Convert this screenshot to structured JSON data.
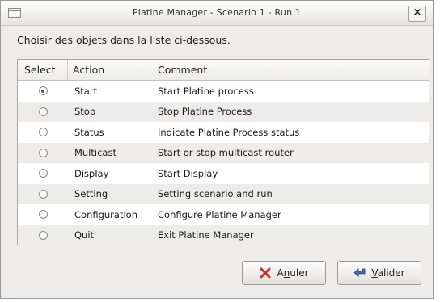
{
  "window": {
    "title": "Platine Manager - Scenario 1 - Run 1",
    "close_label": "×"
  },
  "instruction": "Choisir des objets dans la liste ci-dessous.",
  "table": {
    "headers": {
      "select": "Select",
      "action": "Action",
      "comment": "Comment"
    },
    "rows": [
      {
        "action": "Start",
        "comment": "Start Platine process",
        "selected": true
      },
      {
        "action": "Stop",
        "comment": "Stop Platine Process",
        "selected": false
      },
      {
        "action": "Status",
        "comment": "Indicate Platine Process status",
        "selected": false
      },
      {
        "action": "Multicast",
        "comment": "Start or stop multicast router",
        "selected": false
      },
      {
        "action": "Display",
        "comment": "Start Display",
        "selected": false
      },
      {
        "action": "Setting",
        "comment": "Setting scenario and run",
        "selected": false
      },
      {
        "action": "Configuration",
        "comment": "Configure Platine Manager",
        "selected": false
      },
      {
        "action": "Quit",
        "comment": "Exit Platine Manager",
        "selected": false
      }
    ]
  },
  "buttons": {
    "cancel": {
      "mnemonic": "n",
      "rest": "uler",
      "prefix": "A",
      "icon": "cancel-x-icon",
      "icon_color": "#d0301f"
    },
    "ok": {
      "mnemonic": "V",
      "rest": "alider",
      "prefix": "",
      "icon": "ok-arrow-icon",
      "icon_color": "#3a6fb0"
    }
  }
}
